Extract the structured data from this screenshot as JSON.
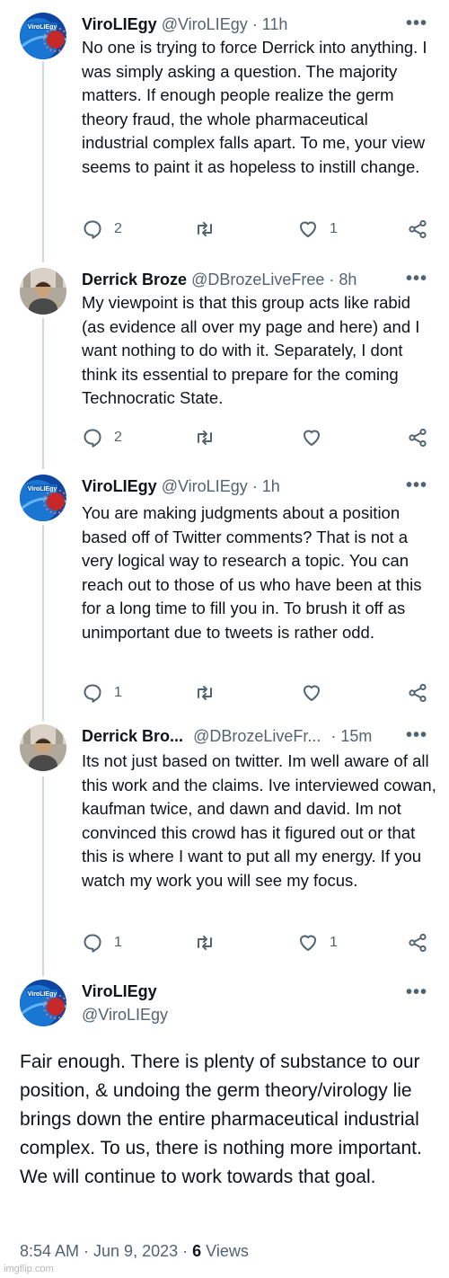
{
  "tweets": [
    {
      "name": "ViroLIEgy",
      "handle": "@ViroLIEgy",
      "time": "· 11h",
      "text": "No one is trying to force Derrick into anything. I was simply asking a question. The majority matters. If enough people realize the germ theory fraud, the whole pharmaceutical industrial complex falls apart. To me, your view seems to paint it as hopeless to instill change.",
      "replies": "2",
      "retweets": "",
      "likes": "1",
      "avatar": "virology-logo-icon"
    },
    {
      "name": "Derrick Broze",
      "handle": "@DBrozeLiveFree",
      "time": "· 8h",
      "text": "My viewpoint is that this group acts like rabid (as evidence all over my page and here) and I want nothing to do with it. Separately, I dont think its essential to prepare for the coming Technocratic State.",
      "replies": "2",
      "retweets": "",
      "likes": "",
      "avatar": "person-photo-icon"
    },
    {
      "name": "ViroLIEgy",
      "handle": "@ViroLIEgy",
      "time": "· 1h",
      "text": "You are making judgments about a position based off of Twitter comments? That is not a very logical way to research a topic. You can reach out to those of us who have been at this for a long time to fill you in. To brush it off as unimportant due to tweets is rather odd.",
      "replies": "1",
      "retweets": "",
      "likes": "",
      "avatar": "virology-logo-icon"
    },
    {
      "name": "Derrick Bro...",
      "handle": "@DBrozeLiveFr...",
      "time": "· 15m",
      "text": "Its not just based on twitter. Im well aware of all this work and the claims. Ive interviewed cowan, kaufman twice, and dawn and david. Im not convinced this crowd has it figured out or that this is where I want to put all my energy. If you watch my work you will see my focus.",
      "replies": "1",
      "retweets": "",
      "likes": "1",
      "avatar": "person-photo-icon"
    }
  ],
  "main_tweet": {
    "name": "ViroLIEgy",
    "handle": "@ViroLIEgy",
    "text": "Fair enough. There is plenty of substance to our position, & undoing the germ theory/virology lie brings down the entire pharmaceutical industrial complex. To us, there is nothing more important. We will continue to work towards that goal.",
    "timestamp": "8:54 AM · Jun 9, 2023 ·",
    "views_count": "6",
    "views_label": "Views"
  },
  "more_label": "•••",
  "avatar_logo_text": "ViroLIEgy",
  "watermark": "imgflip.com",
  "colors": {
    "text": "#0f1419",
    "muted": "#536471",
    "thread_line": "#cfd9de",
    "logo_blue": "#1565c0",
    "logo_red": "#c62828"
  }
}
